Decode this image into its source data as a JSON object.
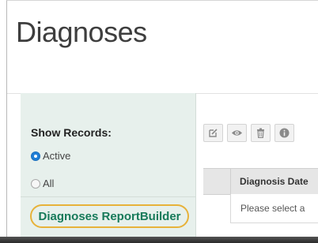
{
  "page": {
    "title": "Diagnoses"
  },
  "sidebar": {
    "show_records_label": "Show Records:",
    "filters": [
      {
        "label": "Active",
        "selected": true
      },
      {
        "label": "All",
        "selected": false
      }
    ],
    "report_builder_link": "Diagnoses ReportBuilder"
  },
  "toolbar": {
    "buttons": [
      {
        "icon": "edit-icon"
      },
      {
        "icon": "eye-icon"
      },
      {
        "icon": "trash-icon"
      },
      {
        "icon": "info-icon"
      }
    ]
  },
  "grid": {
    "columns": [
      "Diagnosis Date"
    ],
    "empty_message": "Please select a"
  },
  "colors": {
    "accent": "#177a5a",
    "highlight": "#e7b23a",
    "radio": "#1f7ed6",
    "sidebar_bg": "#e7f0ec"
  }
}
